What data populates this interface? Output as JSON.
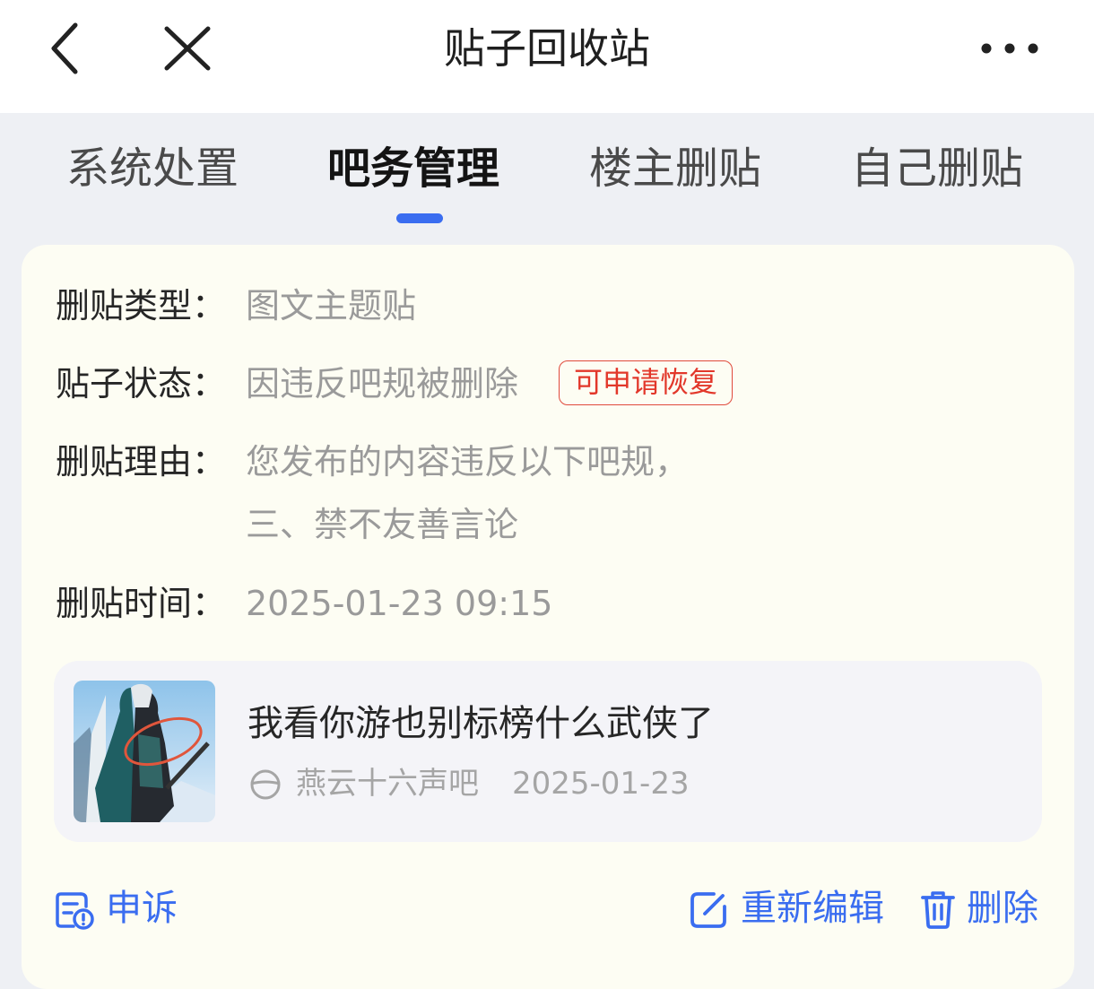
{
  "header": {
    "title": "贴子回收站"
  },
  "tabs": [
    {
      "label": "系统处置"
    },
    {
      "label": "吧务管理"
    },
    {
      "label": "楼主删贴"
    },
    {
      "label": "自己删贴"
    }
  ],
  "active_tab": "吧务管理",
  "details": {
    "type_label": "删贴类型：",
    "type_value": "图文主题贴",
    "status_label": "贴子状态：",
    "status_value": "因违反吧规被删除",
    "status_badge": "可申请恢复",
    "reason_label": "删贴理由：",
    "reason_line1": "您发布的内容违反以下吧规，",
    "reason_line2": "三、禁不友善言论",
    "time_label": "删贴时间：",
    "time_value": "2025-01-23 09:15"
  },
  "post": {
    "title": "我看你游也别标榜什么武侠了",
    "forum": "燕云十六声吧",
    "date": "2025-01-23"
  },
  "actions": {
    "appeal": "申诉",
    "reedit": "重新编辑",
    "delete": "删除"
  },
  "colors": {
    "accent": "#3a6df0",
    "badge_red": "#e2372a",
    "card_bg": "#fdfdf3",
    "page_bg": "#eef0f4"
  },
  "icons": [
    "back-icon",
    "close-icon",
    "more-icon",
    "forum-icon",
    "appeal-icon",
    "edit-icon",
    "trash-icon"
  ]
}
